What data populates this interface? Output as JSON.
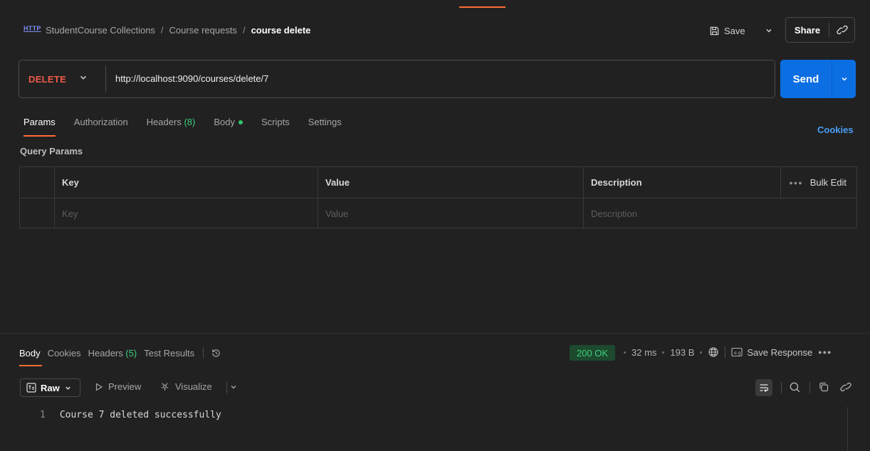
{
  "colors": {
    "background": "#212121",
    "accent": "#ff6c37",
    "send": "#0c6ee3",
    "method_delete": "#f05a4a",
    "success": "#3ed07a",
    "link": "#4a9ff5"
  },
  "header": {
    "http_badge": "HTTP",
    "breadcrumb": [
      "StudentCourse Collections",
      "Course requests"
    ],
    "separator": "/",
    "current": "course delete",
    "save_label": "Save",
    "share_label": "Share"
  },
  "request": {
    "method": "DELETE",
    "url": "http://localhost:9090/courses/delete/7",
    "send_label": "Send"
  },
  "tabs": {
    "params": "Params",
    "authorization": "Authorization",
    "headers": "Headers",
    "headers_count": "(8)",
    "body": "Body",
    "scripts": "Scripts",
    "settings": "Settings",
    "cookies": "Cookies"
  },
  "query_params": {
    "title": "Query Params",
    "columns": {
      "key": "Key",
      "value": "Value",
      "description": "Description"
    },
    "bulk_edit": "Bulk Edit",
    "placeholders": {
      "key": "Key",
      "value": "Value",
      "description": "Description"
    }
  },
  "response": {
    "tabs": {
      "body": "Body",
      "cookies": "Cookies",
      "headers": "Headers",
      "headers_count": "(5)",
      "test_results": "Test Results"
    },
    "status": "200 OK",
    "time": "32 ms",
    "size": "193 B",
    "save_response": "Save Response",
    "view": {
      "raw": "Raw",
      "preview": "Preview",
      "visualize": "Visualize"
    },
    "lines": [
      {
        "number": "1",
        "text": "Course 7 deleted successfully"
      }
    ]
  },
  "icons": {
    "save": "save-icon",
    "share_link": "link-icon",
    "history": "history-icon",
    "globe": "globe-icon",
    "wrap": "wrap-lines-icon",
    "search": "search-icon",
    "copy": "copy-icon",
    "link": "link-icon"
  }
}
